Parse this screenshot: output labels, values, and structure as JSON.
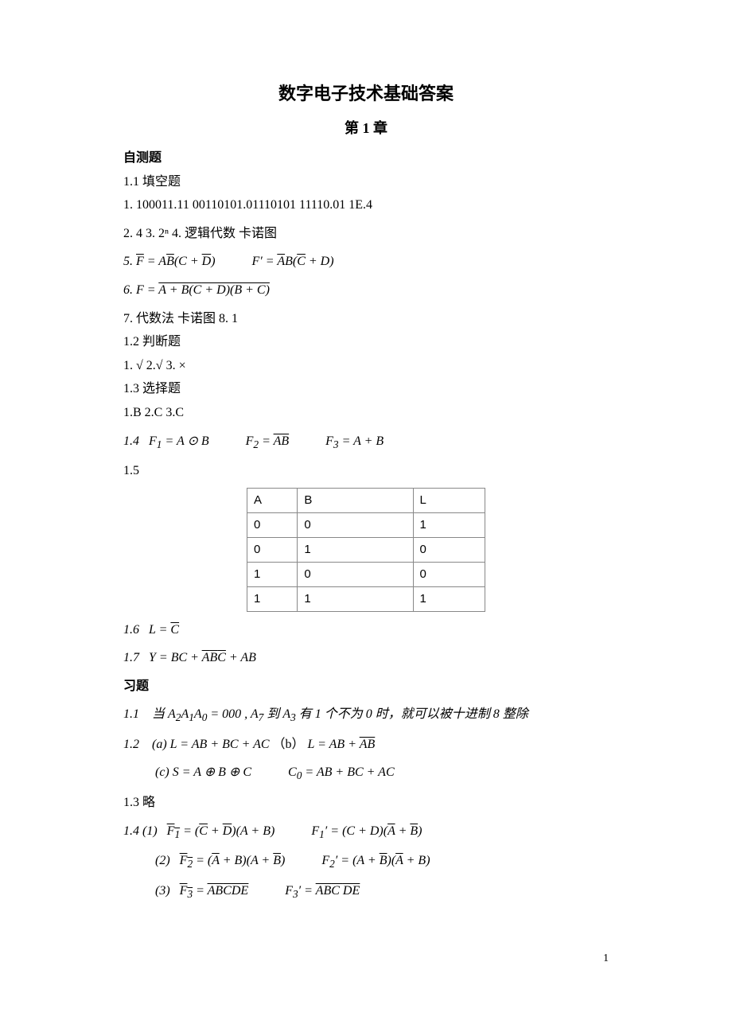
{
  "title": "数字电子技术基础答案",
  "chapter": "第 1 章",
  "section_selftest": "自测题",
  "s11_head": "1.1 填空题",
  "s11_q1": "1. 100011.11    00110101.01110101    11110.01      1E.4",
  "s11_q2": "2. 4        3.  2ⁿ        4. 逻辑代数  卡诺图",
  "s11_q7": "7.  代数法  卡诺图      8. 1",
  "s12_head": "1.2 判断题",
  "s12_line": "1. √      2.√      3. ×",
  "s13_head": "1.3 选择题",
  "s13_line": "1.B    2.C    3.C",
  "s15_head": "1.5",
  "truth_table": {
    "header": [
      "A",
      "B",
      "L"
    ],
    "rows": [
      [
        "0",
        "0",
        "1"
      ],
      [
        "0",
        "1",
        "0"
      ],
      [
        "1",
        "0",
        "0"
      ],
      [
        "1",
        "1",
        "1"
      ]
    ]
  },
  "section_exercise": "习题",
  "ex13": "1.3 略",
  "page_number": "1"
}
